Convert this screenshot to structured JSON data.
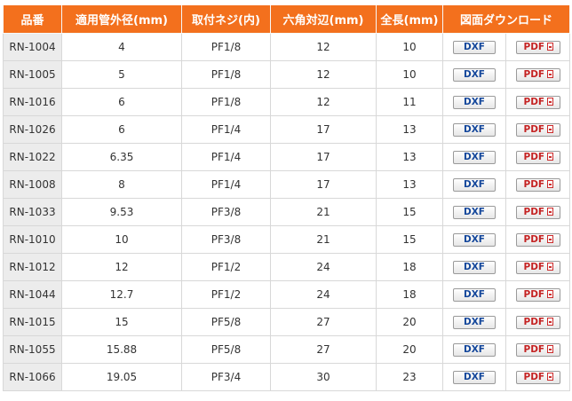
{
  "table": {
    "headers": [
      "品番",
      "適用管外径(mm)",
      "取付ネジ(内)",
      "六角対辺(mm)",
      "全長(mm)",
      "図面ダウンロード"
    ],
    "dxf_label": "DXF",
    "pdf_label": "PDF",
    "rows": [
      {
        "part_no": "RN-1004",
        "outer_diameter": "4",
        "thread": "PF1/8",
        "hex": "12",
        "length": "10"
      },
      {
        "part_no": "RN-1005",
        "outer_diameter": "5",
        "thread": "PF1/8",
        "hex": "12",
        "length": "10"
      },
      {
        "part_no": "RN-1016",
        "outer_diameter": "6",
        "thread": "PF1/8",
        "hex": "12",
        "length": "11"
      },
      {
        "part_no": "RN-1026",
        "outer_diameter": "6",
        "thread": "PF1/4",
        "hex": "17",
        "length": "13"
      },
      {
        "part_no": "RN-1022",
        "outer_diameter": "6.35",
        "thread": "PF1/4",
        "hex": "17",
        "length": "13"
      },
      {
        "part_no": "RN-1008",
        "outer_diameter": "8",
        "thread": "PF1/4",
        "hex": "17",
        "length": "13"
      },
      {
        "part_no": "RN-1033",
        "outer_diameter": "9.53",
        "thread": "PF3/8",
        "hex": "21",
        "length": "15"
      },
      {
        "part_no": "RN-1010",
        "outer_diameter": "10",
        "thread": "PF3/8",
        "hex": "21",
        "length": "15"
      },
      {
        "part_no": "RN-1012",
        "outer_diameter": "12",
        "thread": "PF1/2",
        "hex": "24",
        "length": "18"
      },
      {
        "part_no": "RN-1044",
        "outer_diameter": "12.7",
        "thread": "PF1/2",
        "hex": "24",
        "length": "18"
      },
      {
        "part_no": "RN-1015",
        "outer_diameter": "15",
        "thread": "PF5/8",
        "hex": "27",
        "length": "20"
      },
      {
        "part_no": "RN-1055",
        "outer_diameter": "15.88",
        "thread": "PF5/8",
        "hex": "27",
        "length": "20"
      },
      {
        "part_no": "RN-1066",
        "outer_diameter": "19.05",
        "thread": "PF3/4",
        "hex": "30",
        "length": "23"
      }
    ]
  },
  "colors": {
    "header_bg": "#f3701d",
    "dxf_text": "#14479b",
    "pdf_text": "#c42222"
  },
  "icons": {
    "pdf": "pdf-file-icon"
  }
}
